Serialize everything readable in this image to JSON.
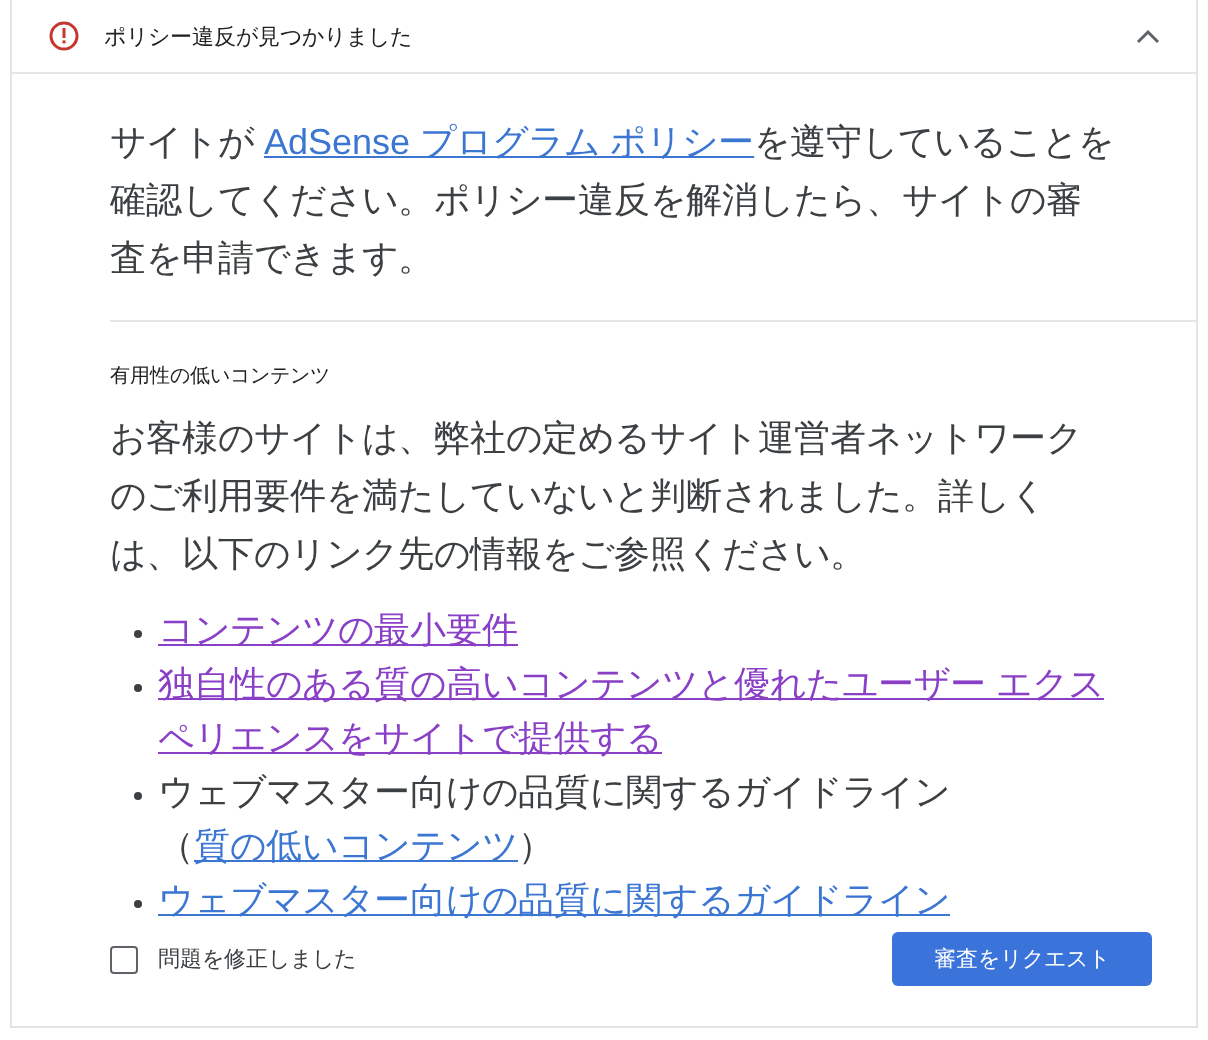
{
  "header": {
    "title": "ポリシー違反が見つかりました",
    "expanded": true
  },
  "intro": [
    {
      "kind": "text",
      "text": "サイトが "
    },
    {
      "kind": "link",
      "text": "AdSense プログラム ポリシー",
      "visited": false
    },
    {
      "kind": "text",
      "text": "を遵守していることを確認してください。ポリシー違反を解消したら、サイトの審査を申請できます。"
    }
  ],
  "section": {
    "heading": "有用性の低いコンテンツ",
    "description": "お客様のサイトは、弊社の定めるサイト運営者ネットワークのご利用要件を満たしていないと判断されました。詳しくは、以下のリンク先の情報をご参照ください。",
    "items": [
      {
        "parts": [
          {
            "kind": "link",
            "text": "コンテンツの最小要件",
            "visited": true
          }
        ]
      },
      {
        "parts": [
          {
            "kind": "link",
            "text": "独自性のある質の高いコンテンツと優れたユーザー エクスペリエンスをサイトで提供する",
            "visited": true
          }
        ]
      },
      {
        "parts": [
          {
            "kind": "text",
            "text": "ウェブマスター向けの品質に関するガイドライン（"
          },
          {
            "kind": "link",
            "text": "質の低いコンテンツ",
            "visited": false
          },
          {
            "kind": "text",
            "text": "）"
          }
        ]
      },
      {
        "parts": [
          {
            "kind": "link",
            "text": "ウェブマスター向けの品質に関するガイドライン",
            "visited": false
          }
        ]
      }
    ]
  },
  "footer": {
    "checkbox": {
      "label": "問題を修正しました",
      "checked": false
    },
    "button": "審査をリクエスト"
  }
}
